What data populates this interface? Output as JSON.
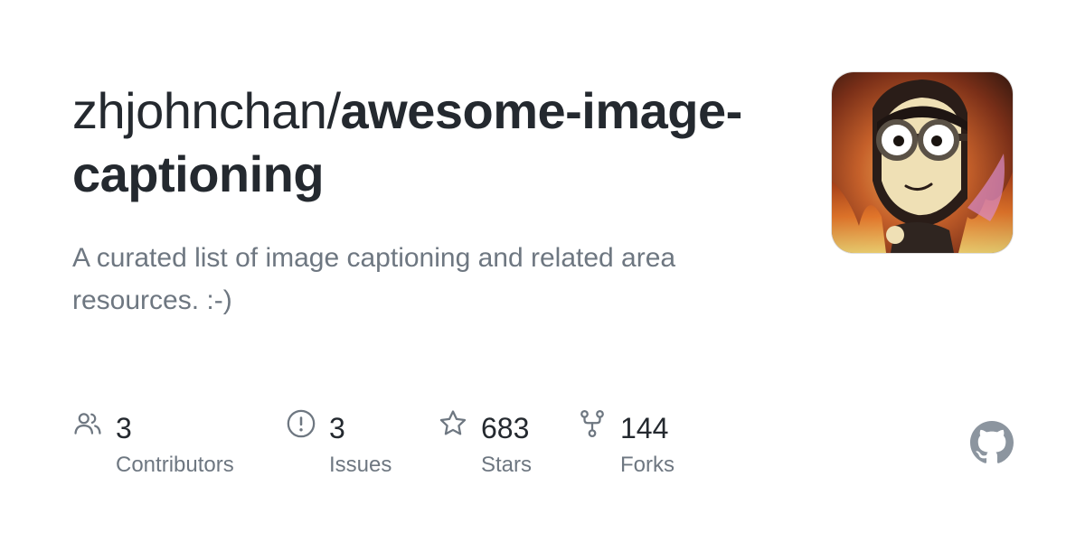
{
  "title": {
    "owner": "zhjohnchan/",
    "repo": "awesome-image-captioning"
  },
  "description": "A curated list of image captioning and related area resources. :-)",
  "stats": {
    "contributors": {
      "count": "3",
      "label": "Contributors",
      "icon": "people-icon"
    },
    "issues": {
      "count": "3",
      "label": "Issues",
      "icon": "issue-icon"
    },
    "stars": {
      "count": "683",
      "label": "Stars",
      "icon": "star-icon"
    },
    "forks": {
      "count": "144",
      "label": "Forks",
      "icon": "fork-icon"
    }
  },
  "colors": {
    "text": "#24292f",
    "muted": "#6e7781",
    "icon": "#6e7781",
    "github_mark": "#8c959f"
  },
  "icons": {
    "brand": "github-mark-icon"
  }
}
